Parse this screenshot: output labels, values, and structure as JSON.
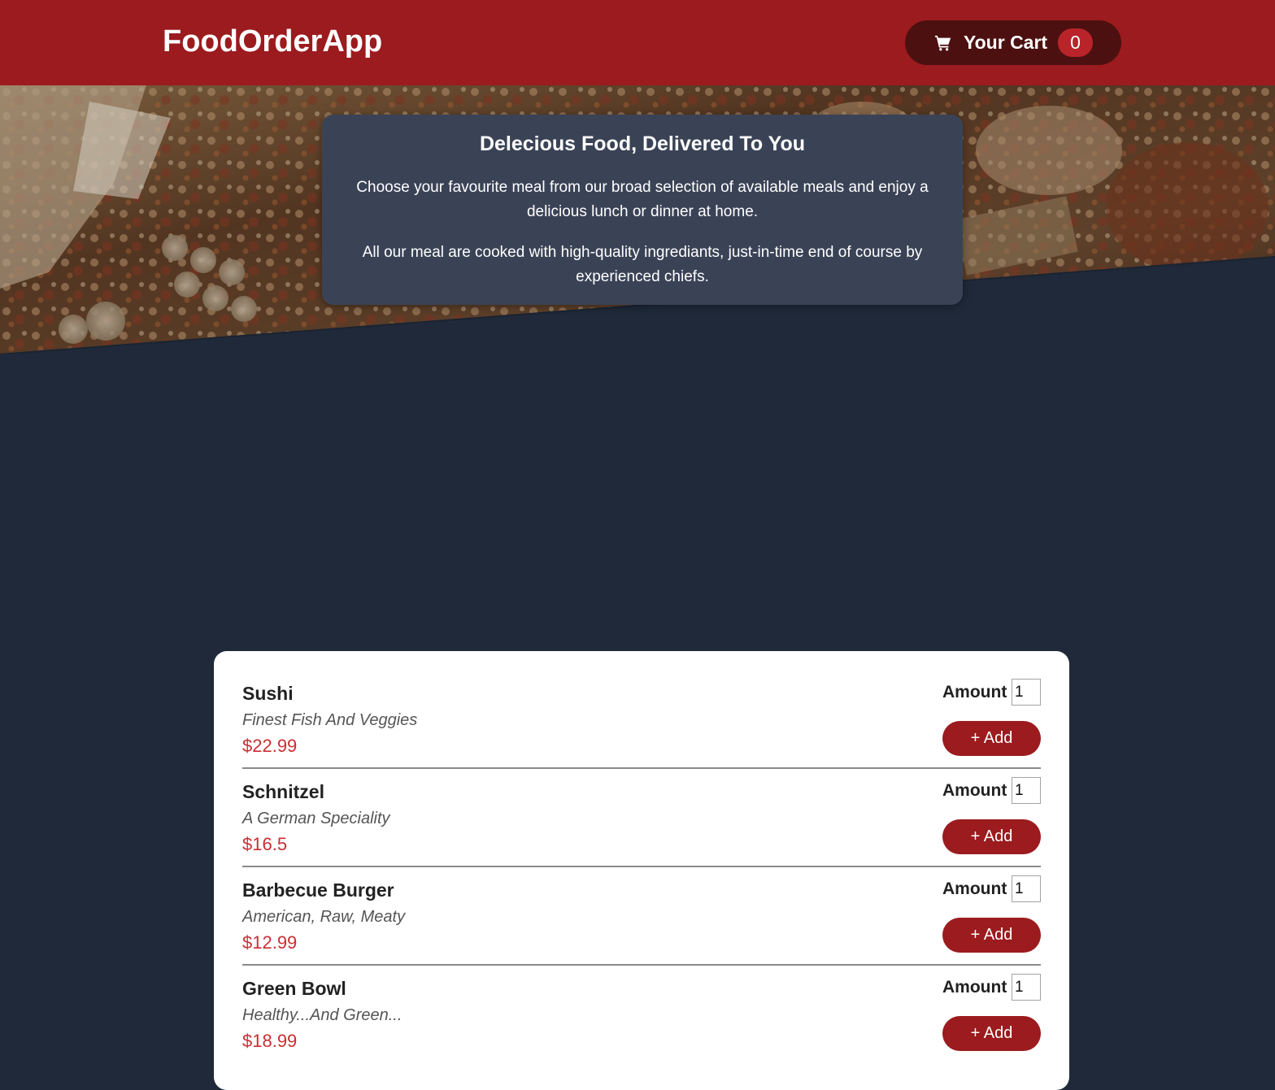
{
  "header": {
    "brand": "FoodOrderApp",
    "cart_label": "Your Cart",
    "cart_count": "0",
    "cart_icon": "shopping-cart-icon"
  },
  "summary": {
    "title": "Delecious Food, Delivered To You",
    "paragraph1": "Choose your favourite meal from our broad selection of available meals and enjoy a delicious lunch or dinner at home.",
    "paragraph2": "All our meal are cooked with high-quality ingrediants, just-in-time end of course by experienced chiefs."
  },
  "meals": [
    {
      "name": "Sushi",
      "description": "Finest Fish And Veggies",
      "price": "$22.99",
      "amount_label": "Amount",
      "amount_value": "1",
      "add_label": "+ Add"
    },
    {
      "name": "Schnitzel",
      "description": "A German Speciality",
      "price": "$16.5",
      "amount_label": "Amount",
      "amount_value": "1",
      "add_label": "+ Add"
    },
    {
      "name": "Barbecue Burger",
      "description": "American, Raw, Meaty",
      "price": "$12.99",
      "amount_label": "Amount",
      "amount_value": "1",
      "add_label": "+ Add"
    },
    {
      "name": "Green Bowl",
      "description": "Healthy...And Green...",
      "price": "$18.99",
      "amount_label": "Amount",
      "amount_value": "1",
      "add_label": "+ Add"
    }
  ],
  "colors": {
    "header": "#9b1b1e",
    "cart_button": "#4d1010",
    "badge": "#b9242a",
    "page_background": "#1f2939",
    "summary_card": "#3a4356",
    "price": "#ca2f33",
    "add_button": "#9b1b1e"
  }
}
